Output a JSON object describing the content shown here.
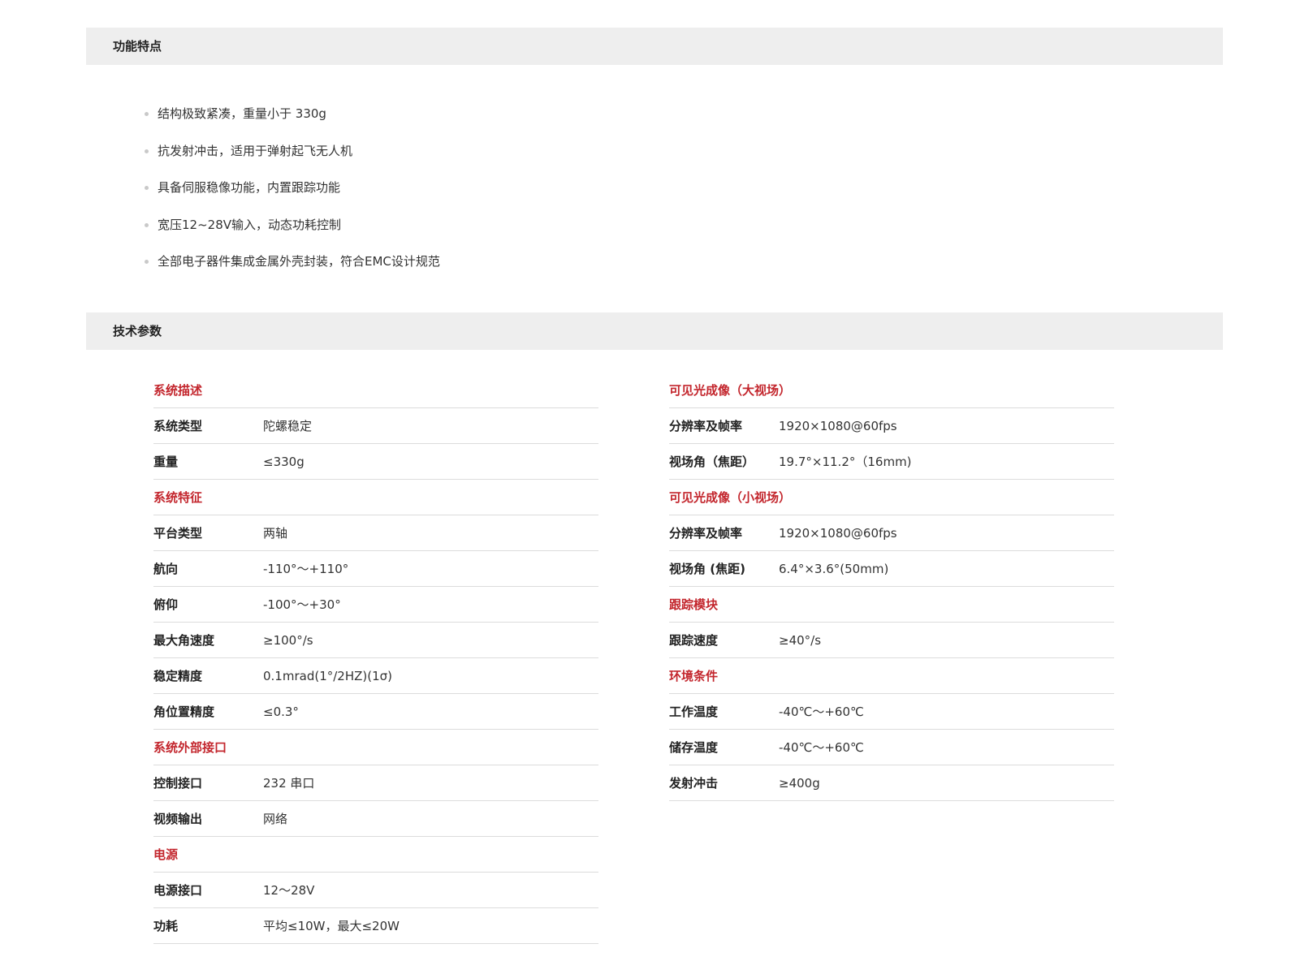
{
  "features_section": {
    "title": "功能特点",
    "items": [
      "结构极致紧凑，重量小于 330g",
      "抗发射冲击，适用于弹射起飞无人机",
      "具备伺服稳像功能，内置跟踪功能",
      "宽压12~28V输入，动态功耗控制",
      "全部电子器件集成金属外壳封装，符合EMC设计规范"
    ]
  },
  "specs_section": {
    "title": "技术参数",
    "left_column": [
      {
        "group": "系统描述",
        "rows": [
          {
            "key": "系统类型",
            "value": "陀螺稳定"
          },
          {
            "key": "重量",
            "value": "≤330g"
          }
        ]
      },
      {
        "group": "系统特征",
        "rows": [
          {
            "key": "平台类型",
            "value": "两轴"
          },
          {
            "key": "航向",
            "value": "-110°～+110°"
          },
          {
            "key": "俯仰",
            "value": "-100°～+30°"
          },
          {
            "key": "最大角速度",
            "value": "≥100°/s"
          },
          {
            "key": "稳定精度",
            "value": "0.1mrad(1°/2HZ)(1σ)"
          },
          {
            "key": "角位置精度",
            "value": "≤0.3°"
          }
        ]
      },
      {
        "group": "系统外部接口",
        "rows": [
          {
            "key": "控制接口",
            "value": "232 串口"
          },
          {
            "key": "视频输出",
            "value": "网络"
          }
        ]
      },
      {
        "group": "电源",
        "rows": [
          {
            "key": "电源接口",
            "value": "12～28V"
          },
          {
            "key": "功耗",
            "value": "平均≤10W，最大≤20W"
          }
        ]
      }
    ],
    "right_column": [
      {
        "group": "可见光成像（大视场）",
        "rows": [
          {
            "key": "分辨率及帧率",
            "value": "1920×1080@60fps"
          },
          {
            "key": "视场角（焦距）",
            "value": "19.7°×11.2°（16mm)"
          }
        ]
      },
      {
        "group": "可见光成像（小视场）",
        "rows": [
          {
            "key": "分辨率及帧率",
            "value": "1920×1080@60fps"
          },
          {
            "key": "视场角 (焦距)",
            "value": "6.4°×3.6°(50mm)"
          }
        ]
      },
      {
        "group": "跟踪模块",
        "rows": [
          {
            "key": "跟踪速度",
            "value": "≥40°/s"
          }
        ]
      },
      {
        "group": "环境条件",
        "rows": [
          {
            "key": "工作温度",
            "value": "-40℃～+60℃"
          },
          {
            "key": "储存温度",
            "value": "-40℃～+60℃"
          },
          {
            "key": "发射冲击",
            "value": "≥400g"
          }
        ]
      }
    ]
  },
  "colors": {
    "header_bg": "#eeeeee",
    "accent_red": "#c3262d",
    "divider": "#dcdcdc",
    "bullet": "#c9c9c9"
  }
}
